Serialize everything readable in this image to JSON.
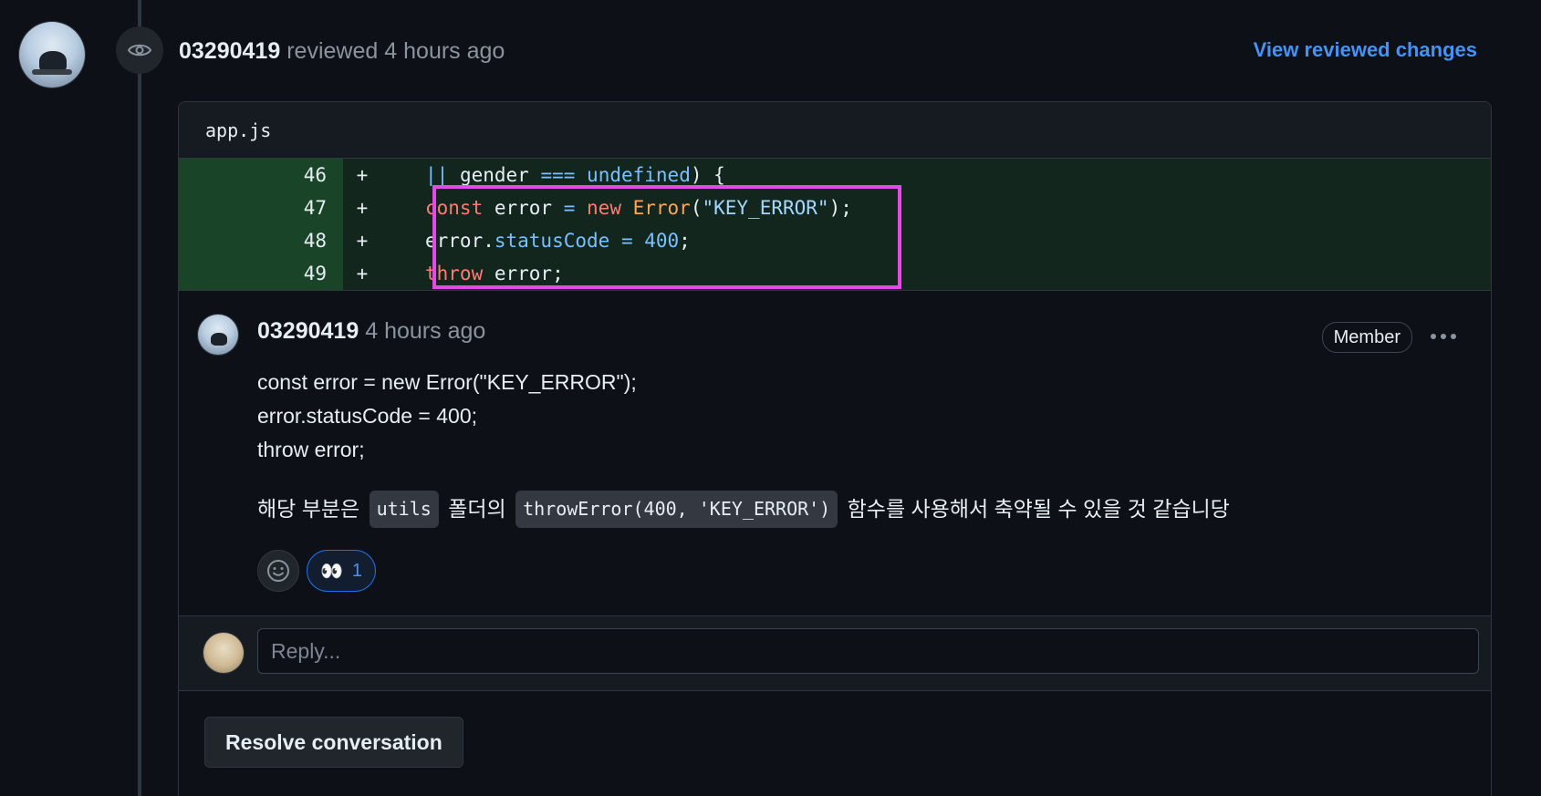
{
  "review": {
    "author": "03290419",
    "action": "reviewed",
    "time": "4 hours ago",
    "view_changes_label": "View reviewed changes"
  },
  "file": {
    "name": "app.js"
  },
  "diff": {
    "lines": [
      {
        "num": "46",
        "sign": "+"
      },
      {
        "num": "47",
        "sign": "+"
      },
      {
        "num": "48",
        "sign": "+"
      },
      {
        "num": "49",
        "sign": "+"
      }
    ],
    "code": {
      "line46": {
        "op": "||",
        "mid": " gender ",
        "eq": "===",
        "undef": "undefined",
        "tail": ") {"
      },
      "line47": {
        "kw1": "const",
        "mid1": " error ",
        "eq": "=",
        "kw2": " new ",
        "fn": "Error",
        "open": "(",
        "str": "\"KEY_ERROR\"",
        "close": ");"
      },
      "line48": {
        "obj": "error.",
        "prop": "statusCode",
        "eq": " = ",
        "num": "400",
        "end": ";"
      },
      "line49": {
        "kw": "throw",
        "rest": " error;"
      }
    }
  },
  "comment": {
    "author": "03290419",
    "time": "4 hours ago",
    "role_badge": "Member",
    "body_lines": [
      "const error = new Error(\"KEY_ERROR\");",
      "error.statusCode = 400;",
      "throw error;"
    ],
    "note": {
      "prefix": "해당 부분은 ",
      "code1": "utils",
      "mid": " 폴더의 ",
      "code2": "throwError(400, 'KEY_ERROR')",
      "suffix": " 함수를 사용해서 축약될 수 있을 것 같습니당"
    },
    "reactions": [
      {
        "emoji": "👀",
        "count": "1"
      }
    ]
  },
  "reply": {
    "placeholder": "Reply..."
  },
  "resolve_label": "Resolve conversation",
  "colors": {
    "accent": "#4493f8",
    "highlight_border": "#e44be6",
    "diff_add_bg": "#12261e",
    "diff_num_bg": "#1a4428"
  }
}
